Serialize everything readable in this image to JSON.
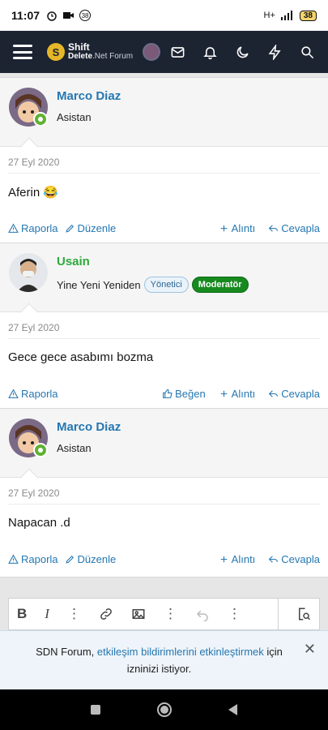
{
  "statusbar": {
    "time": "11:07",
    "notif_count": "38",
    "battery": "38",
    "network": "H+"
  },
  "navbar": {
    "logo_line1": "Shift",
    "logo_line2_a": "Delete",
    "logo_line2_b": ".Net",
    "logo_line2_c": " Forum"
  },
  "posts": [
    {
      "username": "Marco Diaz",
      "user_title": "Asistan",
      "date": "27 Eyl 2020",
      "content": "Aferin 😂",
      "actions_left": [
        "Raporla",
        "Düzenle"
      ],
      "actions_right": [
        "Alıntı",
        "Cevapla"
      ]
    },
    {
      "username": "Usain",
      "user_title": "Yine Yeni Yeniden",
      "badge1": "Yönetici",
      "badge2": "Moderatör",
      "date": "27 Eyl 2020",
      "content": "Gece gece asabımı bozma",
      "actions_left": [
        "Raporla"
      ],
      "actions_right": [
        "Beğen",
        "Alıntı",
        "Cevapla"
      ]
    },
    {
      "username": "Marco Diaz",
      "user_title": "Asistan",
      "date": "27 Eyl 2020",
      "content": "Napacan .d",
      "actions_left": [
        "Raporla",
        "Düzenle"
      ],
      "actions_right": [
        "Alıntı",
        "Cevapla"
      ]
    }
  ],
  "notice": {
    "prefix": "SDN Forum, ",
    "link": "etkileşim bildirimlerini etkinleştirmek",
    "suffix": " için izninizi istiyor.",
    "close": "✕"
  },
  "colors": {
    "navbar": "#1c2331",
    "link": "#2577b1",
    "online": "#5fb233",
    "moderator": "#178a1f"
  }
}
